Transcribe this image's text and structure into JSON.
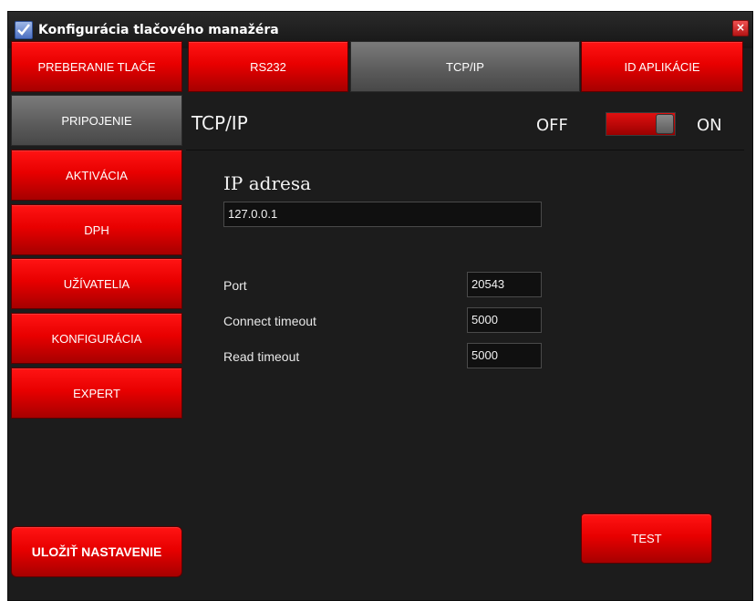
{
  "window": {
    "title": "Konfigurácia tlačového manažéra",
    "close_glyph": "×"
  },
  "sidebar": {
    "items": [
      {
        "label": "PREBERANIE TLAČE",
        "active": false
      },
      {
        "label": "PRIPOJENIE",
        "active": true
      },
      {
        "label": "AKTIVÁCIA",
        "active": false
      },
      {
        "label": "DPH",
        "active": false
      },
      {
        "label": "UŽÍVATELIA",
        "active": false
      },
      {
        "label": "KONFIGURÁCIA",
        "active": false
      },
      {
        "label": "EXPERT",
        "active": false
      }
    ],
    "save_label": "ULOŽIŤ NASTAVENIE"
  },
  "tabs": [
    {
      "label": "RS232",
      "active": false
    },
    {
      "label": "TCP/IP",
      "active": true
    },
    {
      "label": "ID APLIKÁCIE",
      "active": false
    }
  ],
  "section": {
    "title": "TCP/IP",
    "toggle_off_label": "OFF",
    "toggle_on_label": "ON",
    "toggle_state": "on"
  },
  "form": {
    "ip_label": "IP adresa",
    "ip_value": "127.0.0.1",
    "port_label": "Port",
    "port_value": "20543",
    "connect_timeout_label": "Connect timeout",
    "connect_timeout_value": "5000",
    "read_timeout_label": "Read timeout",
    "read_timeout_value": "5000"
  },
  "actions": {
    "test_label": "TEST"
  },
  "colors": {
    "accent_red": "#e80000",
    "background": "#1c1c1c",
    "active_tab": "#5a5a5a"
  }
}
